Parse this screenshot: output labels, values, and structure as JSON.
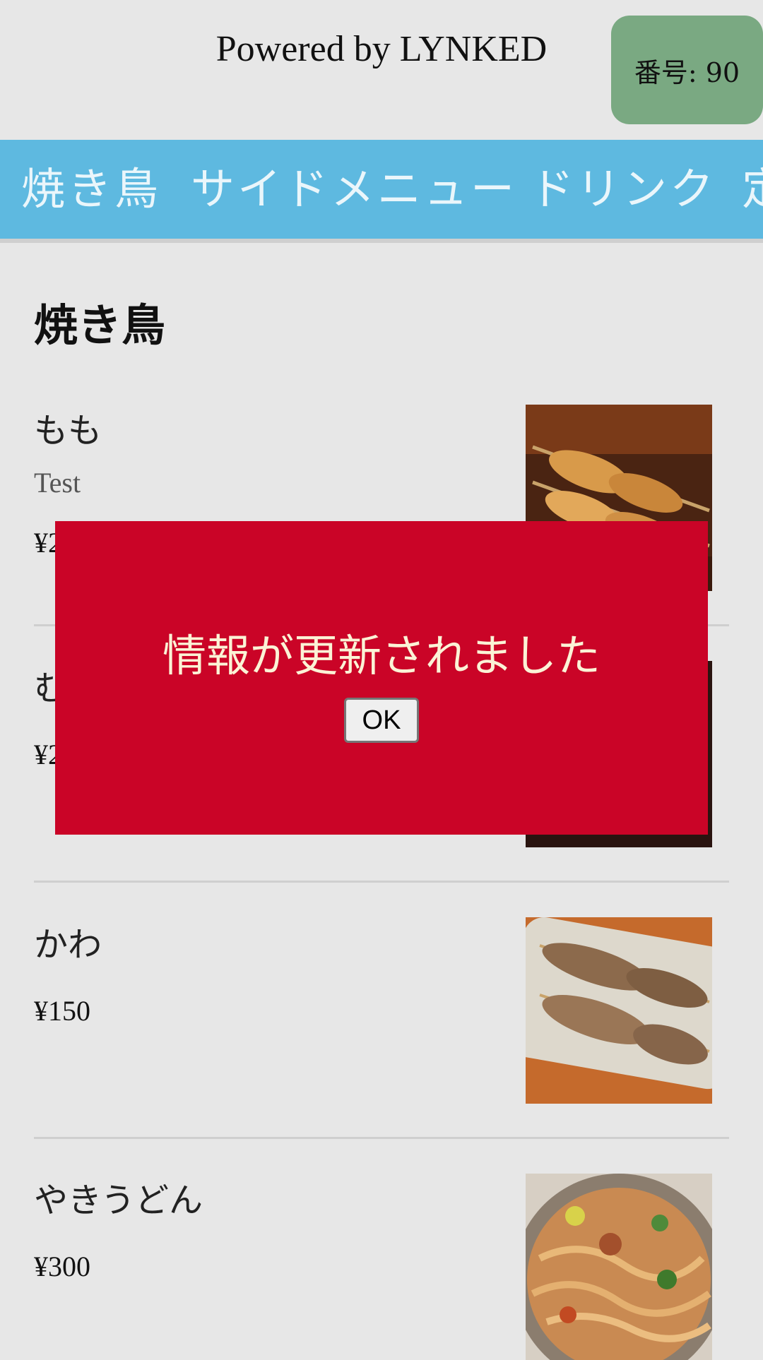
{
  "header": {
    "powered_by": "Powered by LYNKED",
    "ticket_number": "番号: 90"
  },
  "tabs": [
    "焼き鳥",
    "サイドメニュー",
    "ドリンク",
    "定"
  ],
  "section": {
    "title": "焼き鳥"
  },
  "items": [
    {
      "name": "もも",
      "description": "Test",
      "price": "¥2"
    },
    {
      "name": "む",
      "price": "¥2"
    },
    {
      "name": "かわ",
      "price": "¥150"
    },
    {
      "name": "やきうどん",
      "price": "¥300"
    }
  ],
  "modal": {
    "message": "情報が更新されました",
    "ok_label": "OK"
  },
  "colors": {
    "background": "#e7e7e7",
    "tab_bar": "#5eb9e0",
    "ticket_badge": "#7aa982",
    "modal": "#ca0427"
  }
}
